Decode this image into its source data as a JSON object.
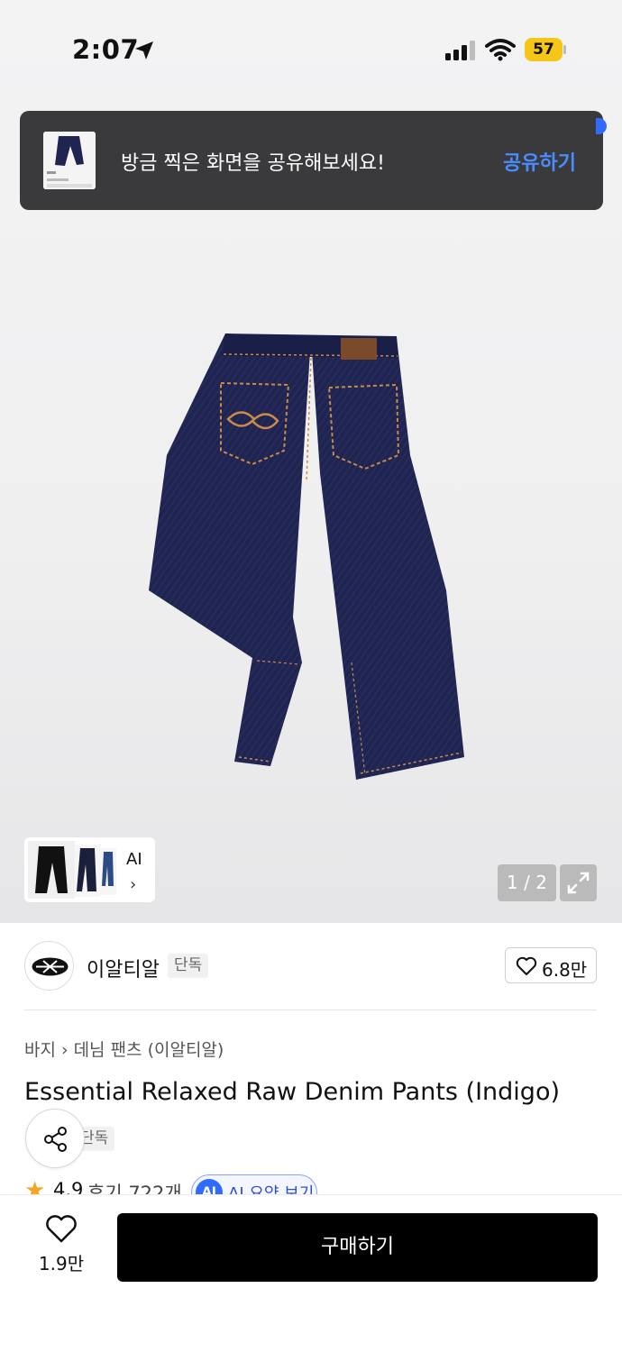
{
  "status_bar": {
    "time": "2:07",
    "battery": "57"
  },
  "toast": {
    "message": "방금 찍은 화면을 공유해보세요!",
    "action": "공유하기"
  },
  "gallery": {
    "thumbs_label": "AI",
    "counter": "1 / 2"
  },
  "brand": {
    "name": "이알티알",
    "badge": "단독",
    "likes": "6.8만"
  },
  "breadcrumb": {
    "category": "바지",
    "subcategory": "데님 팬츠 (이알티알)"
  },
  "product": {
    "title": "Essential Relaxed Raw Denim Pants (Indigo)",
    "badge": "단독",
    "rating": "4.9",
    "reviews": "후기 722개",
    "ai_badge": "AI",
    "ai_summary": "AI 요약 보기"
  },
  "bottom_bar": {
    "wish_count": "1.9만",
    "buy_label": "구매하기"
  },
  "colors": {
    "accent": "#2f6bff",
    "denim": "#1f2450",
    "stitch": "#c98a4a"
  }
}
